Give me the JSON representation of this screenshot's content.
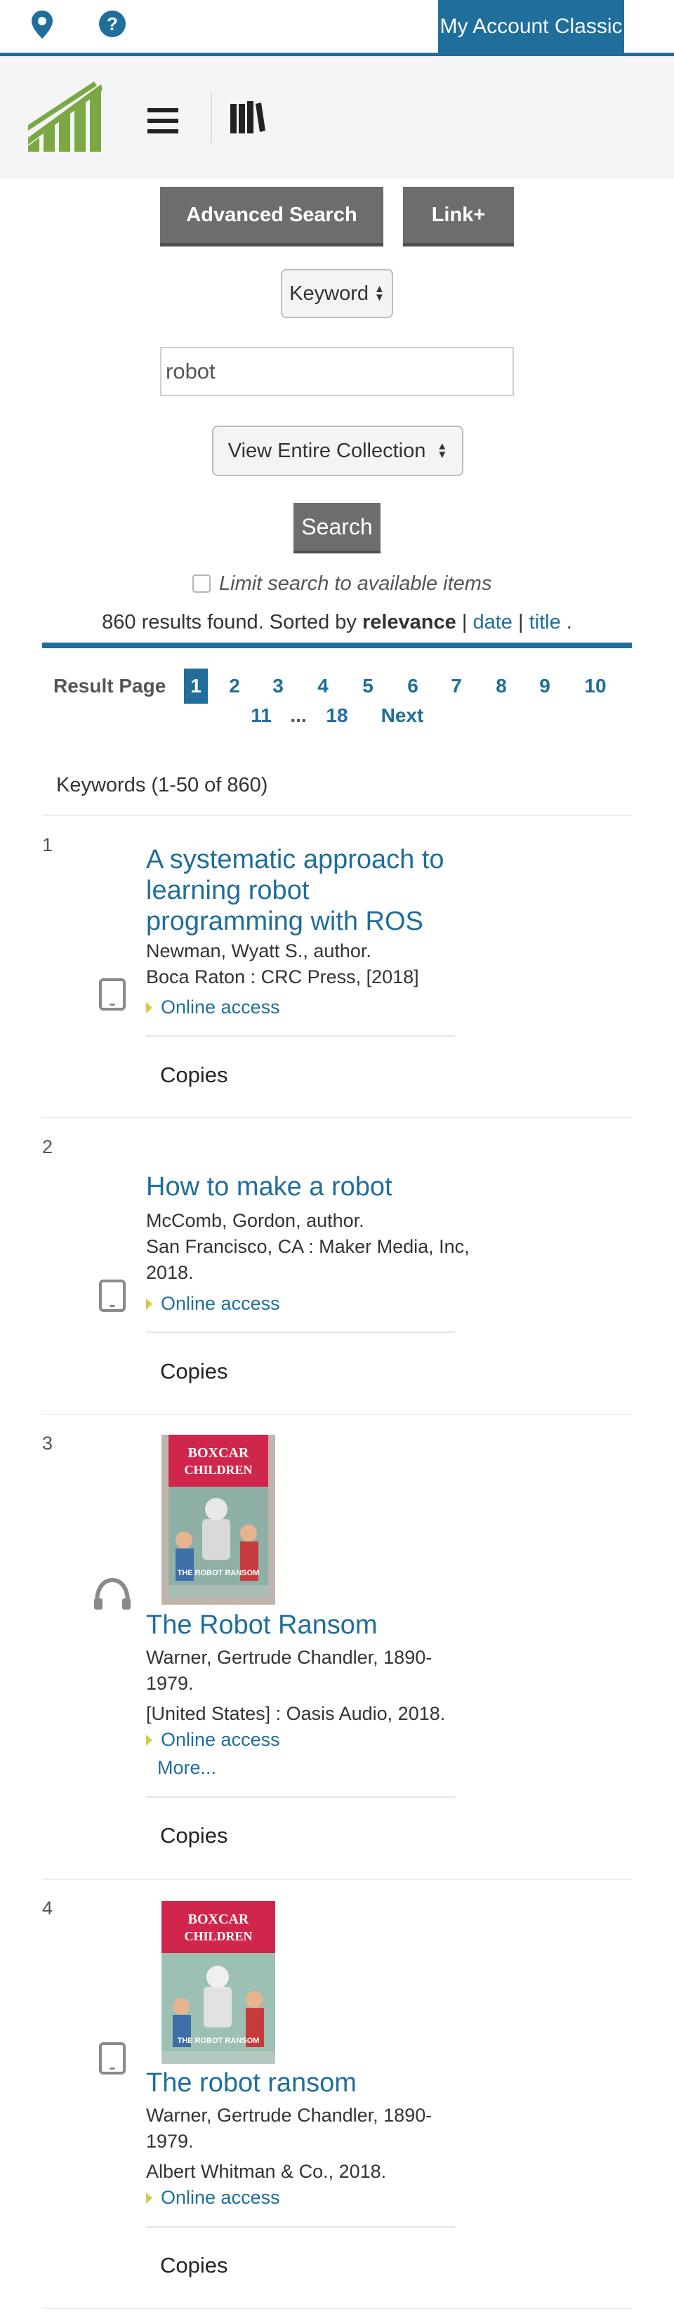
{
  "topbar": {
    "location_icon": "map-marker-icon",
    "help_icon": "question-circle-icon",
    "account_label": "My Account Classic"
  },
  "header": {
    "logo_icon": "library-logo",
    "menu_icon": "hamburger-icon",
    "books_icon": "books-icon"
  },
  "search": {
    "advanced_label": "Advanced Search",
    "linkplus_label": "Link+",
    "search_type": "Keyword",
    "query": "robot",
    "collection": "View Entire Collection",
    "search_label": "Search",
    "limit_label": "Limit search to available items"
  },
  "summary": {
    "prefix": "860 results found. Sorted by",
    "sort_current": "relevance",
    "sep1": "|",
    "sort_date": "date",
    "sep2": "|",
    "sort_title": "title",
    "suffix": "."
  },
  "pagination": {
    "label": "Result Page",
    "current": "1",
    "pages_row1": [
      "2",
      "3",
      "4",
      "5",
      "6",
      "7",
      "8",
      "9",
      "10"
    ],
    "pages_row2": [
      "11",
      "...",
      "18",
      "Next"
    ]
  },
  "keywords_label": "Keywords (1-50 of 860)",
  "results": [
    {
      "number": "1",
      "title_lines": [
        "A systematic approach to",
        "learning robot",
        "programming with ROS"
      ],
      "lines": [
        "Newman, Wyatt S., author.",
        "Boca Raton : CRC Press, [2018]"
      ],
      "online": "Online access",
      "copies": "Copies",
      "format_icon": "tablet-icon"
    },
    {
      "number": "2",
      "title_lines": [
        "How to make a robot"
      ],
      "lines": [
        "McComb, Gordon, author.",
        "San Francisco, CA : Maker Media, Inc,",
        "2018."
      ],
      "online": "Online access",
      "copies": "Copies",
      "format_icon": "tablet-icon"
    },
    {
      "number": "3",
      "title_lines": [
        "The Robot Ransom"
      ],
      "lines": [
        "Warner, Gertrude Chandler, 1890-",
        "1979.",
        "[United States] : Oasis Audio, 2018."
      ],
      "online": "Online access",
      "more": "More...",
      "copies": "Copies",
      "format_icon": "headphones-icon",
      "cover": {
        "series": "THE BOXCAR CHILDREN",
        "title": "THE ROBOT RANSOM"
      }
    },
    {
      "number": "4",
      "title_lines": [
        "The robot ransom"
      ],
      "lines": [
        "Warner, Gertrude Chandler, 1890-",
        "1979.",
        "Albert Whitman & Co., 2018."
      ],
      "online": "Online access",
      "copies": "Copies",
      "format_icon": "tablet-icon",
      "cover": {
        "series": "THE BOXCAR CHILDREN",
        "title": "THE ROBOT RANSOM"
      }
    }
  ],
  "colors": {
    "brand_blue": "#1f6e9c",
    "button_gray": "#6d6d6d",
    "logo_green": "#7aa843",
    "online_marker": "#d9c84a"
  }
}
